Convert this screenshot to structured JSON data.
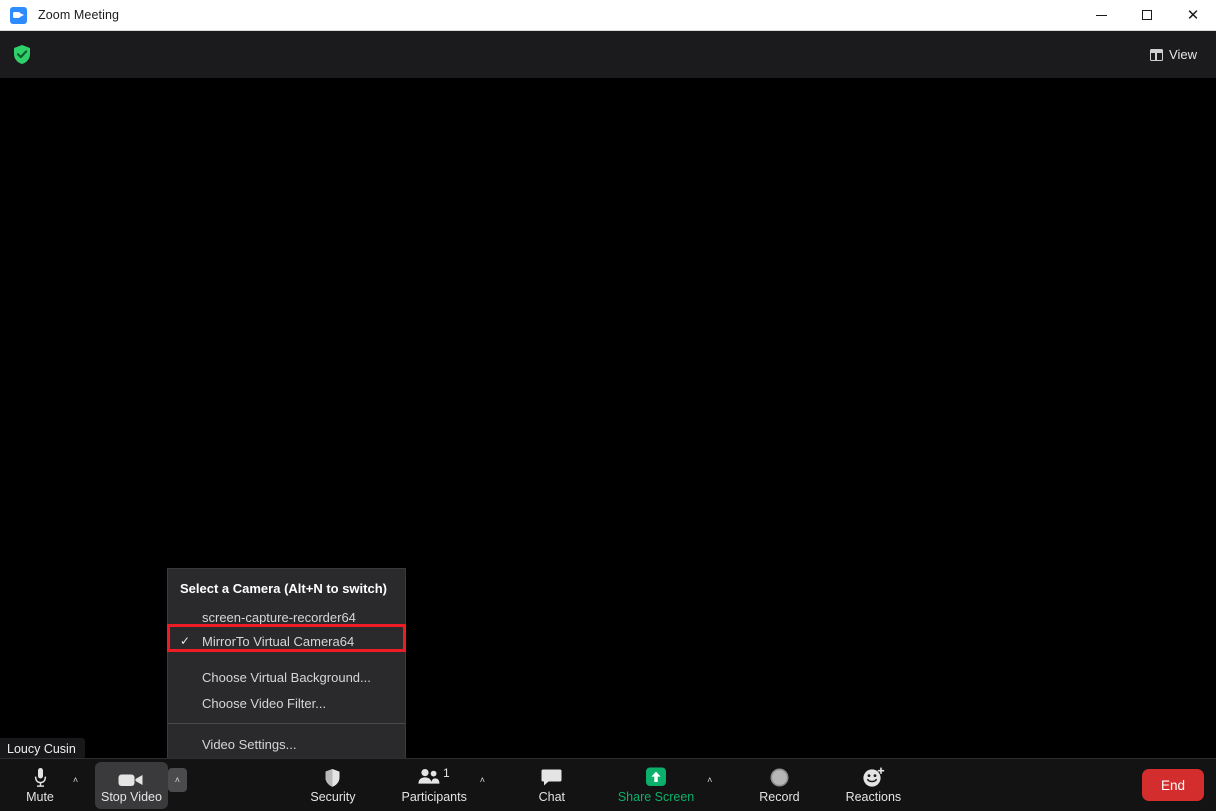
{
  "window": {
    "title": "Zoom Meeting",
    "app_icon": "zoom-camera-icon",
    "controls": {
      "minimize": "—",
      "maximize": "□",
      "close": "✕"
    }
  },
  "header": {
    "encryption_icon": "green-shield-check-icon",
    "view_label": "View",
    "view_icon": "grid-view-icon"
  },
  "stage": {
    "self_view_name": "Loucy Cusin"
  },
  "camera_menu": {
    "title": "Select a Camera (Alt+N to switch)",
    "cameras": [
      {
        "label": "screen-capture-recorder64",
        "checked": false,
        "check_glyph": ""
      },
      {
        "label": "MirrorTo Virtual Camera64",
        "checked": true,
        "check_glyph": "✓"
      }
    ],
    "actions": [
      {
        "label": "Choose Virtual Background..."
      },
      {
        "label": "Choose Video Filter..."
      }
    ],
    "settings": {
      "label": "Video Settings..."
    },
    "highlight_color": "#ee1c25"
  },
  "toolbar": {
    "mute": {
      "label": "Mute",
      "icon": "microphone-icon",
      "caret": "˄"
    },
    "video": {
      "label": "Stop Video",
      "icon": "video-camera-icon",
      "caret": "˄"
    },
    "security": {
      "label": "Security",
      "icon": "shield-icon"
    },
    "participants": {
      "label": "Participants",
      "icon": "people-icon",
      "count": "1",
      "caret": "˄"
    },
    "chat": {
      "label": "Chat",
      "icon": "speech-bubble-icon"
    },
    "share": {
      "label": "Share Screen",
      "icon": "share-up-arrow-icon",
      "caret": "˄",
      "color": "#0bb06b"
    },
    "record": {
      "label": "Record",
      "icon": "record-circle-icon"
    },
    "reactions": {
      "label": "Reactions",
      "icon": "smiley-plus-icon"
    },
    "end": {
      "label": "End",
      "color": "#d32d2d"
    }
  }
}
